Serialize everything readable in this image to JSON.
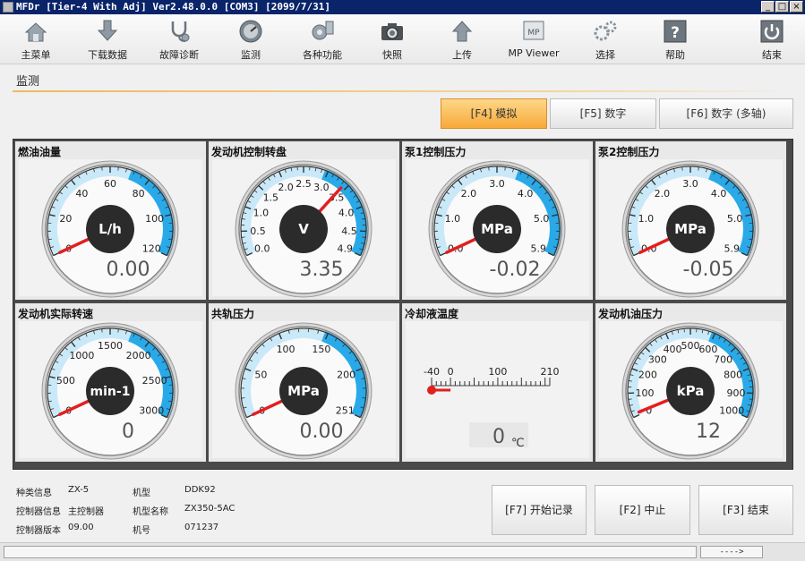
{
  "window": {
    "title": "MFDr [Tier-4 With Adj] Ver2.48.0.0 [COM3] [2099/7/31]",
    "controls": [
      "_",
      "□",
      "×"
    ]
  },
  "toolbar": {
    "items": [
      {
        "label": "主菜单",
        "icon": "home-icon"
      },
      {
        "label": "下载数据",
        "icon": "download-icon"
      },
      {
        "label": "故障诊断",
        "icon": "stethoscope-icon"
      },
      {
        "label": "监测",
        "icon": "gauge-icon"
      },
      {
        "label": "各种功能",
        "icon": "functions-icon"
      },
      {
        "label": "快照",
        "icon": "camera-icon"
      },
      {
        "label": "上传",
        "icon": "upload-icon"
      },
      {
        "label": "MP Viewer",
        "icon": "mp-viewer-icon"
      },
      {
        "label": "选择",
        "icon": "gears-icon"
      },
      {
        "label": "帮助",
        "icon": "help-icon"
      },
      {
        "label": "结束",
        "icon": "power-icon"
      }
    ]
  },
  "section": {
    "title": "监测"
  },
  "modes": [
    {
      "label": "[F4] 模拟",
      "active": true
    },
    {
      "label": "[F5] 数字",
      "active": false
    },
    {
      "label": "[F6] 数字 (多轴)",
      "active": false
    }
  ],
  "gauges": [
    {
      "title": "燃油油量",
      "unit": "L/h",
      "value": 0,
      "display": "0.00",
      "min": 0,
      "max": 120,
      "ticks": [
        "0",
        "20",
        "40",
        "60",
        "80",
        "100",
        "120"
      ],
      "kind": "dial"
    },
    {
      "title": "发动机控制转盘",
      "unit": "V",
      "value": 3.35,
      "display": "3.35",
      "min": 0,
      "max": 4.9,
      "ticks": [
        "0.0",
        "0.5",
        "1.0",
        "1.5",
        "2.0",
        "2.5",
        "3.0",
        "3.5",
        "4.0",
        "4.5",
        "4.9"
      ],
      "kind": "dial"
    },
    {
      "title": "泵1控制压力",
      "unit": "MPa",
      "value": -0.02,
      "display": "-0.02",
      "min": 0,
      "max": 5.9,
      "ticks": [
        "0.0",
        "1.0",
        "2.0",
        "3.0",
        "4.0",
        "5.0",
        "5.9"
      ],
      "kind": "dial"
    },
    {
      "title": "泵2控制压力",
      "unit": "MPa",
      "value": -0.05,
      "display": "-0.05",
      "min": 0,
      "max": 5.9,
      "ticks": [
        "0.0",
        "1.0",
        "2.0",
        "3.0",
        "4.0",
        "5.0",
        "5.9"
      ],
      "kind": "dial"
    },
    {
      "title": "发动机实际转速",
      "unit": "min-1",
      "value": 0,
      "display": "0",
      "min": 0,
      "max": 3000,
      "ticks": [
        "0",
        "500",
        "1000",
        "1500",
        "2000",
        "2500",
        "3000"
      ],
      "kind": "dial"
    },
    {
      "title": "共轨压力",
      "unit": "MPa",
      "value": 0,
      "display": "0.00",
      "min": 0,
      "max": 251,
      "ticks": [
        "0",
        "50",
        "100",
        "150",
        "200",
        "251"
      ],
      "kind": "dial"
    },
    {
      "title": "冷却液温度",
      "unit": "℃",
      "value": 0,
      "display": "0",
      "min": -40,
      "max": 210,
      "ticks": [
        "-40",
        "0",
        "100",
        "210"
      ],
      "kind": "thermo"
    },
    {
      "title": "发动机油压力",
      "unit": "kPa",
      "value": 12,
      "display": "12",
      "min": 0,
      "max": 1000,
      "ticks": [
        "0",
        "100",
        "200",
        "300",
        "400",
        "500",
        "600",
        "700",
        "800",
        "900",
        "1000"
      ],
      "kind": "dial"
    }
  ],
  "info": {
    "type_label": "种类信息",
    "type_value": "ZX-5",
    "ctrl_label": "控制器信息",
    "ctrl_value": "主控制器",
    "ver_label": "控制器版本",
    "ver_value": "09.00",
    "model_label": "机型",
    "model_value": "DDK92",
    "name_label": "机型名称",
    "name_value": "ZX350-5AC",
    "serial_label": "机号",
    "serial_value": "071237"
  },
  "actions": {
    "start": "[F7] 开始记录",
    "stop": "[F2] 中止",
    "end": "[F3] 结束"
  },
  "status": {
    "arrow": "---->"
  },
  "colors": {
    "accent": "#29a9e8",
    "needle": "#e41e1e",
    "active_tab": "#f7a938",
    "title_bar": "#0a246a"
  }
}
